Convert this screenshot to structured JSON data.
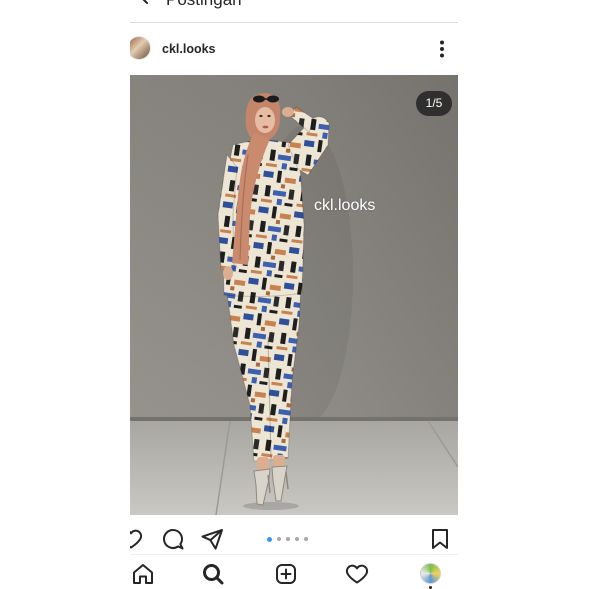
{
  "header": {
    "title": "Postingan",
    "back_icon": "arrow-left-icon"
  },
  "post": {
    "username": "ckl.looks",
    "avatar_icon": "profile-avatar-icon",
    "more_icon": "more-vertical-icon",
    "media": {
      "counter": "1/5",
      "watermark": "ckl.looks"
    },
    "carousel": {
      "total": 5,
      "active": 1
    },
    "actions": {
      "like_icon": "heart-icon",
      "comment_icon": "comment-icon",
      "share_icon": "share-icon",
      "save_icon": "bookmark-icon"
    }
  },
  "bottom_nav": {
    "items": [
      {
        "icon": "home-icon",
        "active": false
      },
      {
        "icon": "search-icon",
        "active": true
      },
      {
        "icon": "add-post-icon",
        "active": false
      },
      {
        "icon": "activity-heart-icon",
        "active": false
      },
      {
        "icon": "profile-avatar-icon",
        "active": false
      }
    ]
  },
  "colors": {
    "accent": "#3897f0",
    "text": "#262626",
    "dot_inactive": "#a8a8a8",
    "badge_bg": "#262626",
    "border": "#dbdbdb"
  }
}
